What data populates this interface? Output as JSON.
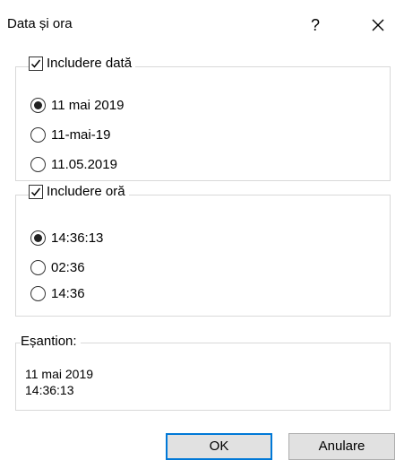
{
  "dialog": {
    "title": "Data și ora",
    "help_label": "?",
    "close_icon": "close-icon"
  },
  "date_group": {
    "label": "Includere dată",
    "checked": true,
    "options": [
      {
        "label": "11 mai 2019",
        "selected": true
      },
      {
        "label": "11-mai-19",
        "selected": false
      },
      {
        "label": "11.05.2019",
        "selected": false
      }
    ]
  },
  "time_group": {
    "label": "Includere oră",
    "checked": true,
    "options": [
      {
        "label": "14:36:13",
        "selected": true
      },
      {
        "label": "02:36",
        "selected": false
      },
      {
        "label": "14:36",
        "selected": false
      }
    ]
  },
  "sample_group": {
    "label": "Eșantion:",
    "line1": "11 mai 2019",
    "line2": "14:36:13"
  },
  "buttons": {
    "ok": "OK",
    "cancel": "Anulare"
  },
  "colors": {
    "accent": "#0078d7",
    "button_bg": "#e1e1e1"
  }
}
